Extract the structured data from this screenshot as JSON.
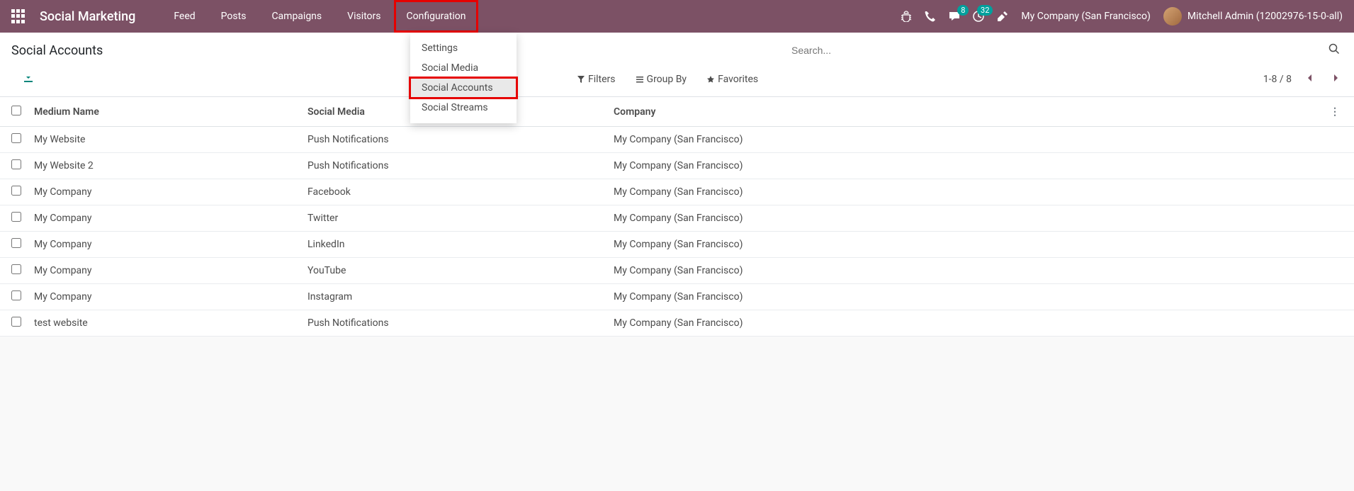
{
  "topbar": {
    "app_title": "Social Marketing",
    "nav": [
      {
        "label": "Feed"
      },
      {
        "label": "Posts"
      },
      {
        "label": "Campaigns"
      },
      {
        "label": "Visitors"
      },
      {
        "label": "Configuration",
        "highlighted": true
      }
    ],
    "messages_badge": "8",
    "activities_badge": "32",
    "company": "My Company (San Francisco)",
    "user": "Mitchell Admin (12002976-15-0-all)"
  },
  "dropdown": {
    "items": [
      {
        "label": "Settings"
      },
      {
        "label": "Social Media"
      },
      {
        "label": "Social Accounts",
        "selected": true
      },
      {
        "label": "Social Streams"
      }
    ]
  },
  "control_panel": {
    "breadcrumb": "Social Accounts",
    "search_placeholder": "Search...",
    "filters_label": "Filters",
    "groupby_label": "Group By",
    "favorites_label": "Favorites",
    "pager": "1-8 / 8"
  },
  "table": {
    "columns": {
      "medium": "Medium Name",
      "social": "Social Media",
      "company": "Company"
    },
    "rows": [
      {
        "medium": "My Website",
        "social": "Push Notifications",
        "company": "My Company (San Francisco)"
      },
      {
        "medium": "My Website 2",
        "social": "Push Notifications",
        "company": "My Company (San Francisco)"
      },
      {
        "medium": "My Company",
        "social": "Facebook",
        "company": "My Company (San Francisco)"
      },
      {
        "medium": "My Company",
        "social": "Twitter",
        "company": "My Company (San Francisco)"
      },
      {
        "medium": "My Company",
        "social": "LinkedIn",
        "company": "My Company (San Francisco)"
      },
      {
        "medium": "My Company",
        "social": "YouTube",
        "company": "My Company (San Francisco)"
      },
      {
        "medium": "My Company",
        "social": "Instagram",
        "company": "My Company (San Francisco)"
      },
      {
        "medium": "test website",
        "social": "Push Notifications",
        "company": "My Company (San Francisco)"
      }
    ]
  }
}
